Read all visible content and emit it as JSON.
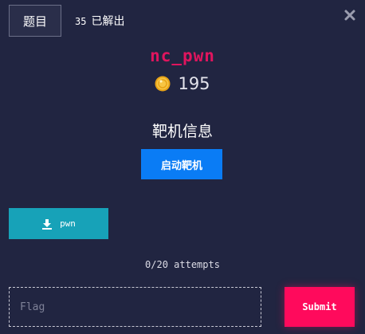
{
  "header": {
    "tab_label": "题目",
    "solved_count": "35",
    "solved_label": "已解出",
    "close_icon": "close-icon"
  },
  "challenge": {
    "title": "nc_pwn",
    "points": "195",
    "coin_icon": "coin-icon",
    "title_color": "#e0155e"
  },
  "target": {
    "section_title": "靶机信息",
    "start_label": "启动靶机"
  },
  "attachment": {
    "icon": "download-icon",
    "label": "pwn"
  },
  "attempts": "0/20 attempts",
  "flag": {
    "placeholder": "Flag",
    "value": "",
    "submit_label": "Submit"
  },
  "colors": {
    "background": "#212541",
    "primary": "#0a7cf5",
    "download": "#17a2b8",
    "submit": "#ff0a5c"
  }
}
